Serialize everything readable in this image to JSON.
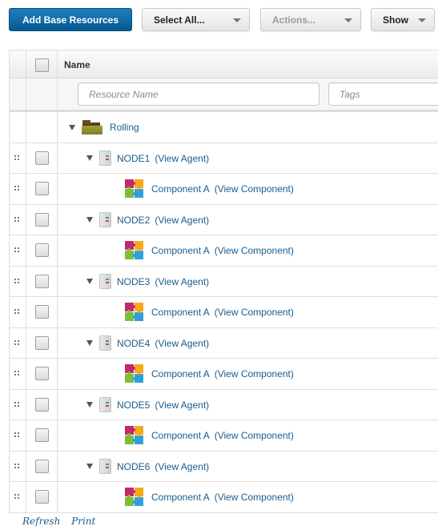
{
  "toolbar": {
    "add_base_resources": "Add Base Resources",
    "select_all": "Select All...",
    "actions": "Actions...",
    "show": "Show"
  },
  "table": {
    "columns": {
      "name": "Name"
    },
    "filters": {
      "resource_name_placeholder": "Resource Name",
      "resource_name_value": "",
      "tags_placeholder": "Tags",
      "tags_value": ""
    },
    "root": {
      "label": "Rolling",
      "icon": "folder-icon",
      "expanded": true
    },
    "nodes": [
      {
        "name": "NODE1",
        "link": "(View Agent)",
        "icon": "agent-icon",
        "expanded": true,
        "component": {
          "name": "Component A",
          "link": "(View Component)",
          "icon": "component-puzzle-icon"
        }
      },
      {
        "name": "NODE2",
        "link": "(View Agent)",
        "icon": "agent-icon",
        "expanded": true,
        "component": {
          "name": "Component A",
          "link": "(View Component)",
          "icon": "component-puzzle-icon"
        }
      },
      {
        "name": "NODE3",
        "link": "(View Agent)",
        "icon": "agent-icon",
        "expanded": true,
        "component": {
          "name": "Component A",
          "link": "(View Component)",
          "icon": "component-puzzle-icon"
        }
      },
      {
        "name": "NODE4",
        "link": "(View Agent)",
        "icon": "agent-icon",
        "expanded": true,
        "component": {
          "name": "Component A",
          "link": "(View Component)",
          "icon": "component-puzzle-icon"
        }
      },
      {
        "name": "NODE5",
        "link": "(View Agent)",
        "icon": "agent-icon",
        "expanded": true,
        "component": {
          "name": "Component A",
          "link": "(View Component)",
          "icon": "component-puzzle-icon"
        }
      },
      {
        "name": "NODE6",
        "link": "(View Agent)",
        "icon": "agent-icon",
        "expanded": true,
        "component": {
          "name": "Component A",
          "link": "(View Component)",
          "icon": "component-puzzle-icon"
        }
      }
    ]
  },
  "footer": {
    "refresh": "Refresh",
    "print": "Print"
  },
  "colors": {
    "primary": "#05598f",
    "link": "#1a5c8c"
  }
}
